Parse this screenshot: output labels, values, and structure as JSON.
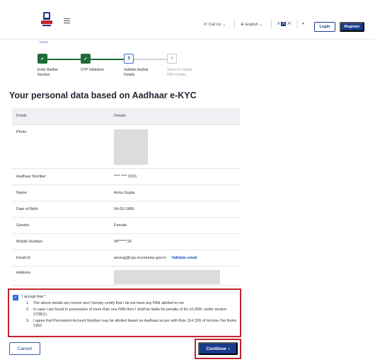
{
  "header": {
    "call_us": "Call Us",
    "language": "English",
    "login": "Login",
    "register": "Register",
    "font_decrease": "A",
    "font_normal": "A",
    "font_increase": "A⁺"
  },
  "breadcrumb": {
    "home": "Home"
  },
  "steps": [
    {
      "number": "1",
      "label_line1": "Enter Aadhar",
      "label_line2": "Number",
      "status": "done"
    },
    {
      "number": "2",
      "label_line1": "OTP Validation",
      "label_line2": "",
      "status": "done"
    },
    {
      "number": "3",
      "label_line1": "Validate Aadhar",
      "label_line2": "Details",
      "status": "active"
    },
    {
      "number": "4",
      "label_line1": "Select & Update",
      "label_line2": "PAN Details",
      "status": "todo"
    }
  ],
  "page_title": "Your personal data based on Aadhaar e-KYC",
  "table": {
    "headers": [
      "Fields",
      "Details"
    ],
    "rows": {
      "photo": {
        "field": "Photo"
      },
      "aadhaar": {
        "field": "Aadhaar Number",
        "value": "**** **** 2031"
      },
      "name": {
        "field": "Name",
        "value": "Annu Gupta"
      },
      "dob": {
        "field": "Date of Birth",
        "value": "04-03-1989"
      },
      "gender": {
        "field": "Gender",
        "value": "Female"
      },
      "mobile": {
        "field": "Mobile Number",
        "value": "99******26"
      },
      "email": {
        "field": "Email id",
        "value": "anurag@cpc.incometax.gov.in",
        "link": "Validate email"
      },
      "address": {
        "field": "Address"
      }
    }
  },
  "consent": {
    "checked": true,
    "title": "I accept that *",
    "items": [
      {
        "num": "1.",
        "text": "The above details are correct and I hereby certify that I do not have any PAN allotted to me."
      },
      {
        "num": "2.",
        "text": "In case I am found in possession of more than one PAN then I shall be liable for penalty of Rs 10,000/- under section 272B(1)."
      },
      {
        "num": "3.",
        "text": "I agree that Permanent Account Number may be allotted based on Aadhaar as per with Rule 114 (1B) of Income-Tax Rules 1962."
      }
    ]
  },
  "actions": {
    "cancel": "Cancel",
    "continue": "Continue",
    "continue_icon": "›"
  },
  "colors": {
    "primary": "#1a3a8a",
    "step_done": "#1f6b3a",
    "highlight": "#c0262e",
    "link": "#2356c0"
  }
}
